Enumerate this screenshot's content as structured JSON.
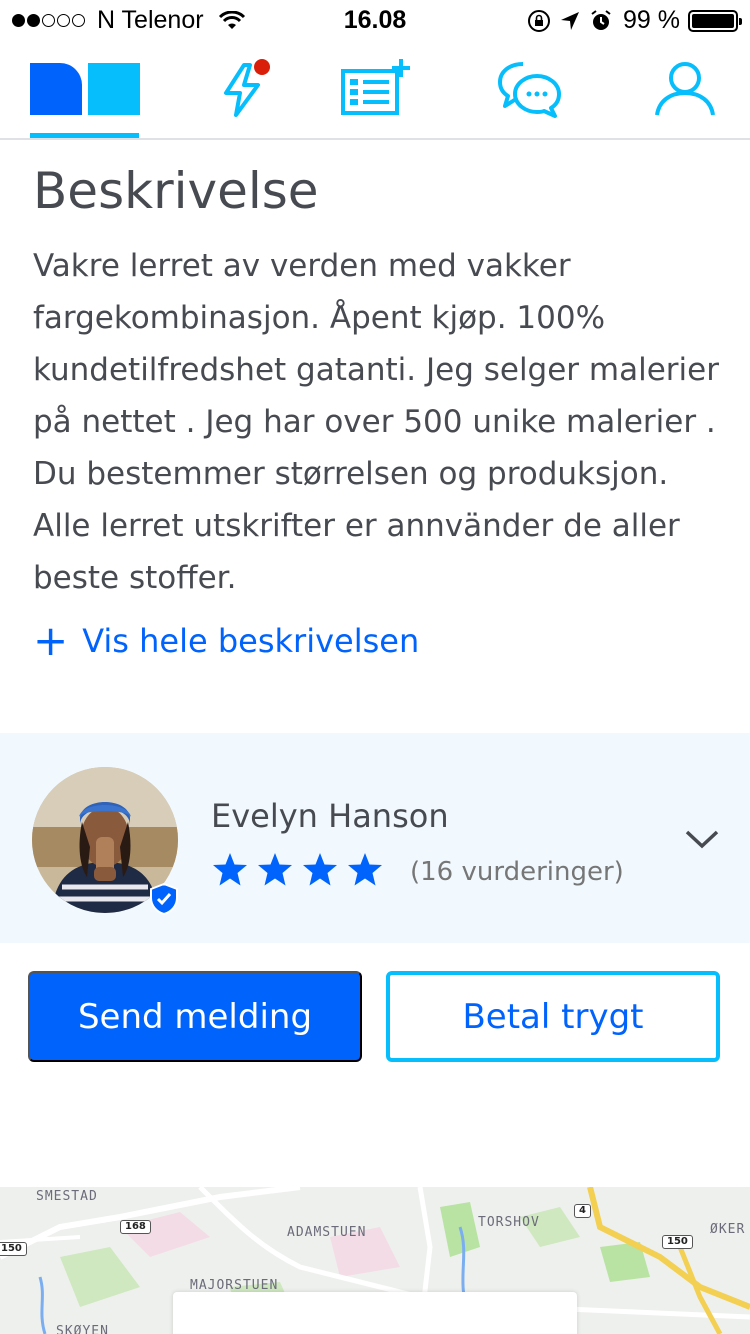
{
  "status_bar": {
    "carrier": "N Telenor",
    "time": "16.08",
    "battery": "99 %",
    "battery_level": 0.99,
    "signal_bars": 2
  },
  "tab_bar": {
    "active_tab": "home",
    "tabs": [
      {
        "id": "home",
        "icon": "finn-logo-icon"
      },
      {
        "id": "notifications",
        "icon": "lightning-icon",
        "badge": true
      },
      {
        "id": "new-ad",
        "icon": "new-ad-icon"
      },
      {
        "id": "messages",
        "icon": "chat-bubbles-icon"
      },
      {
        "id": "profile",
        "icon": "person-icon"
      }
    ]
  },
  "description": {
    "title": "Beskrivelse",
    "body": "Vakre lerret av verden med vakker\nfargekombinasjon. Åpent kjøp. 100%\nkundetilfredshet gatanti. Jeg selger malerier\npå nettet . Jeg har over 500 unike malerier .\nDu bestemmer størrelsen og produksjon.\nAlle lerret utskrifter er  annvänder de aller\nbeste stoffer.",
    "show_more_label": "Vis hele beskrivelsen",
    "show_more_icon": "plus-icon"
  },
  "seller": {
    "name": "Evelyn Hanson",
    "stars": 4,
    "ratings_label": "(16 vurderinger)",
    "verified": true
  },
  "actions": {
    "send_message_label": "Send melding",
    "pay_safely_label": "Betal trygt"
  },
  "map": {
    "labels": [
      "SMESTAD",
      "ADAMSTUEN",
      "TORSHOV",
      "MAJORSTUEN",
      "SKØYEN",
      "ØKER"
    ],
    "road_numbers": [
      "150",
      "168",
      "4",
      "150"
    ]
  },
  "colors": {
    "brand_blue": "#0063fb",
    "accent_cyan": "#06befb",
    "panel_bg": "#f1f9ff",
    "badge_red": "#d91f0a"
  }
}
